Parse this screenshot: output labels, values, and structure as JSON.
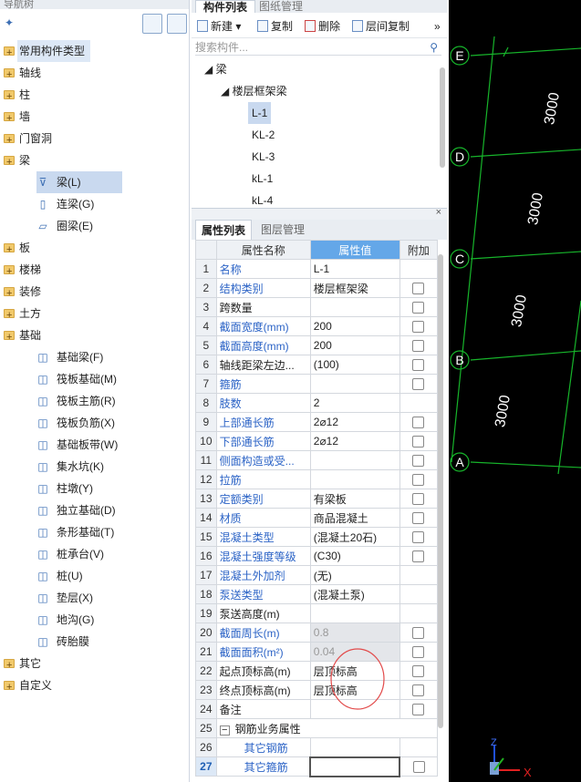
{
  "left_panel": {
    "header": "导航树",
    "categories": [
      {
        "label": "常用构件类型"
      },
      {
        "label": "轴线"
      },
      {
        "label": "柱"
      },
      {
        "label": "墙"
      },
      {
        "label": "门窗洞"
      },
      {
        "label": "梁"
      },
      {
        "label": "板"
      },
      {
        "label": "楼梯"
      },
      {
        "label": "装修"
      },
      {
        "label": "土方"
      },
      {
        "label": "基础"
      },
      {
        "label": "其它"
      },
      {
        "label": "自定义"
      }
    ],
    "beam_items": [
      {
        "label": "梁(L)",
        "icon": "beam-icon"
      },
      {
        "label": "连梁(G)",
        "icon": "coupling-beam-icon"
      },
      {
        "label": "圈梁(E)",
        "icon": "ring-beam-icon"
      }
    ],
    "foundation_items": [
      {
        "label": "基础梁(F)"
      },
      {
        "label": "筏板基础(M)"
      },
      {
        "label": "筏板主筋(R)"
      },
      {
        "label": "筏板负筋(X)"
      },
      {
        "label": "基础板带(W)"
      },
      {
        "label": "集水坑(K)"
      },
      {
        "label": "柱墩(Y)"
      },
      {
        "label": "独立基础(D)"
      },
      {
        "label": "条形基础(T)"
      },
      {
        "label": "桩承台(V)"
      },
      {
        "label": "桩(U)"
      },
      {
        "label": "垫层(X)"
      },
      {
        "label": "地沟(G)"
      },
      {
        "label": "砖胎膜"
      }
    ]
  },
  "component_list": {
    "tab_active": "构件列表",
    "tab_other": "图纸管理",
    "toolbar": {
      "new": "新建",
      "copy": "复制",
      "delete": "删除",
      "floor_copy": "层间复制",
      "more": "»"
    },
    "search_placeholder": "搜索构件...",
    "tree": {
      "root": "梁",
      "group": "楼层框架梁",
      "items": [
        "L-1",
        "KL-2",
        "KL-3",
        "kL-1",
        "kL-4"
      ]
    }
  },
  "property_list": {
    "tab_active": "属性列表",
    "tab_other": "图层管理",
    "col_name": "属性名称",
    "col_value": "属性值",
    "col_extra": "附加",
    "rows": [
      {
        "n": "1",
        "name": "名称",
        "value": "L-1",
        "blue": true,
        "chk": false
      },
      {
        "n": "2",
        "name": "结构类别",
        "value": "楼层框架梁",
        "blue": true,
        "chk": true
      },
      {
        "n": "3",
        "name": "跨数量",
        "value": "",
        "blue": false,
        "chk": true
      },
      {
        "n": "4",
        "name": "截面宽度(mm)",
        "value": "200",
        "blue": true,
        "chk": true
      },
      {
        "n": "5",
        "name": "截面高度(mm)",
        "value": "200",
        "blue": true,
        "chk": true
      },
      {
        "n": "6",
        "name": "轴线距梁左边...",
        "value": "(100)",
        "blue": false,
        "chk": true
      },
      {
        "n": "7",
        "name": "箍筋",
        "value": "",
        "blue": true,
        "chk": true
      },
      {
        "n": "8",
        "name": "肢数",
        "value": "2",
        "blue": true,
        "chk": false
      },
      {
        "n": "9",
        "name": "上部通长筋",
        "value": "2⌀12",
        "blue": true,
        "chk": true
      },
      {
        "n": "10",
        "name": "下部通长筋",
        "value": "2⌀12",
        "blue": true,
        "chk": true
      },
      {
        "n": "11",
        "name": "侧面构造或受...",
        "value": "",
        "blue": true,
        "chk": true
      },
      {
        "n": "12",
        "name": "拉筋",
        "value": "",
        "blue": true,
        "chk": true
      },
      {
        "n": "13",
        "name": "定额类别",
        "value": "有梁板",
        "blue": true,
        "chk": true
      },
      {
        "n": "14",
        "name": "材质",
        "value": "商品混凝土",
        "blue": true,
        "chk": true
      },
      {
        "n": "15",
        "name": "混凝土类型",
        "value": "(混凝土20石)",
        "blue": true,
        "chk": true
      },
      {
        "n": "16",
        "name": "混凝土强度等级",
        "value": "(C30)",
        "blue": true,
        "chk": true
      },
      {
        "n": "17",
        "name": "混凝土外加剂",
        "value": "(无)",
        "blue": true,
        "chk": false
      },
      {
        "n": "18",
        "name": "泵送类型",
        "value": "(混凝土泵)",
        "blue": true,
        "chk": false
      },
      {
        "n": "19",
        "name": "泵送高度(m)",
        "value": "",
        "blue": false,
        "chk": false
      },
      {
        "n": "20",
        "name": "截面周长(m)",
        "value": "0.8",
        "blue": true,
        "gray": true,
        "chk": true
      },
      {
        "n": "21",
        "name": "截面面积(m²)",
        "value": "0.04",
        "blue": true,
        "gray": true,
        "chk": true
      },
      {
        "n": "22",
        "name": "起点顶标高(m)",
        "value": "层顶标高",
        "blue": false,
        "chk": true
      },
      {
        "n": "23",
        "name": "终点顶标高(m)",
        "value": "层顶标高",
        "blue": false,
        "chk": true
      },
      {
        "n": "24",
        "name": "备注",
        "value": "",
        "blue": false,
        "chk": true
      },
      {
        "n": "25",
        "name": "钢筋业务属性",
        "value": "",
        "blue": false,
        "group": true,
        "chk": false
      },
      {
        "n": "26",
        "name": "其它钢筋",
        "value": "",
        "blue": true,
        "indent": true,
        "chk": false
      },
      {
        "n": "27",
        "name": "其它箍筋",
        "value": "",
        "blue": true,
        "indent": true,
        "chk": true,
        "current": true
      }
    ]
  },
  "viewport": {
    "axes": [
      "E",
      "D",
      "C",
      "B",
      "A"
    ],
    "dims": [
      "3000",
      "3000",
      "3000",
      "3000"
    ],
    "axis_x": "X",
    "axis_z": "Z",
    "grid_color": "#17b52b"
  }
}
